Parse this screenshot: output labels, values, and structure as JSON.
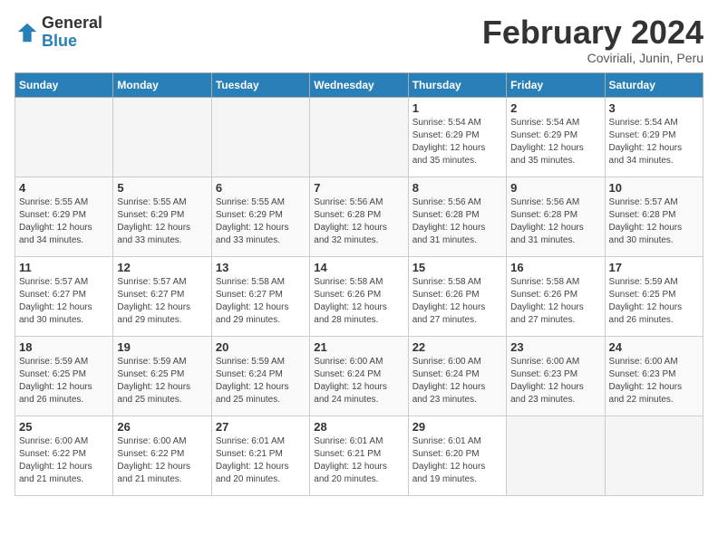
{
  "header": {
    "logo_general": "General",
    "logo_blue": "Blue",
    "month_title": "February 2024",
    "subtitle": "Coviriali, Junin, Peru"
  },
  "days_of_week": [
    "Sunday",
    "Monday",
    "Tuesday",
    "Wednesday",
    "Thursday",
    "Friday",
    "Saturday"
  ],
  "weeks": [
    [
      {
        "day": "",
        "info": ""
      },
      {
        "day": "",
        "info": ""
      },
      {
        "day": "",
        "info": ""
      },
      {
        "day": "",
        "info": ""
      },
      {
        "day": "1",
        "info": "Sunrise: 5:54 AM\nSunset: 6:29 PM\nDaylight: 12 hours\nand 35 minutes."
      },
      {
        "day": "2",
        "info": "Sunrise: 5:54 AM\nSunset: 6:29 PM\nDaylight: 12 hours\nand 35 minutes."
      },
      {
        "day": "3",
        "info": "Sunrise: 5:54 AM\nSunset: 6:29 PM\nDaylight: 12 hours\nand 34 minutes."
      }
    ],
    [
      {
        "day": "4",
        "info": "Sunrise: 5:55 AM\nSunset: 6:29 PM\nDaylight: 12 hours\nand 34 minutes."
      },
      {
        "day": "5",
        "info": "Sunrise: 5:55 AM\nSunset: 6:29 PM\nDaylight: 12 hours\nand 33 minutes."
      },
      {
        "day": "6",
        "info": "Sunrise: 5:55 AM\nSunset: 6:29 PM\nDaylight: 12 hours\nand 33 minutes."
      },
      {
        "day": "7",
        "info": "Sunrise: 5:56 AM\nSunset: 6:28 PM\nDaylight: 12 hours\nand 32 minutes."
      },
      {
        "day": "8",
        "info": "Sunrise: 5:56 AM\nSunset: 6:28 PM\nDaylight: 12 hours\nand 31 minutes."
      },
      {
        "day": "9",
        "info": "Sunrise: 5:56 AM\nSunset: 6:28 PM\nDaylight: 12 hours\nand 31 minutes."
      },
      {
        "day": "10",
        "info": "Sunrise: 5:57 AM\nSunset: 6:28 PM\nDaylight: 12 hours\nand 30 minutes."
      }
    ],
    [
      {
        "day": "11",
        "info": "Sunrise: 5:57 AM\nSunset: 6:27 PM\nDaylight: 12 hours\nand 30 minutes."
      },
      {
        "day": "12",
        "info": "Sunrise: 5:57 AM\nSunset: 6:27 PM\nDaylight: 12 hours\nand 29 minutes."
      },
      {
        "day": "13",
        "info": "Sunrise: 5:58 AM\nSunset: 6:27 PM\nDaylight: 12 hours\nand 29 minutes."
      },
      {
        "day": "14",
        "info": "Sunrise: 5:58 AM\nSunset: 6:26 PM\nDaylight: 12 hours\nand 28 minutes."
      },
      {
        "day": "15",
        "info": "Sunrise: 5:58 AM\nSunset: 6:26 PM\nDaylight: 12 hours\nand 27 minutes."
      },
      {
        "day": "16",
        "info": "Sunrise: 5:58 AM\nSunset: 6:26 PM\nDaylight: 12 hours\nand 27 minutes."
      },
      {
        "day": "17",
        "info": "Sunrise: 5:59 AM\nSunset: 6:25 PM\nDaylight: 12 hours\nand 26 minutes."
      }
    ],
    [
      {
        "day": "18",
        "info": "Sunrise: 5:59 AM\nSunset: 6:25 PM\nDaylight: 12 hours\nand 26 minutes."
      },
      {
        "day": "19",
        "info": "Sunrise: 5:59 AM\nSunset: 6:25 PM\nDaylight: 12 hours\nand 25 minutes."
      },
      {
        "day": "20",
        "info": "Sunrise: 5:59 AM\nSunset: 6:24 PM\nDaylight: 12 hours\nand 25 minutes."
      },
      {
        "day": "21",
        "info": "Sunrise: 6:00 AM\nSunset: 6:24 PM\nDaylight: 12 hours\nand 24 minutes."
      },
      {
        "day": "22",
        "info": "Sunrise: 6:00 AM\nSunset: 6:24 PM\nDaylight: 12 hours\nand 23 minutes."
      },
      {
        "day": "23",
        "info": "Sunrise: 6:00 AM\nSunset: 6:23 PM\nDaylight: 12 hours\nand 23 minutes."
      },
      {
        "day": "24",
        "info": "Sunrise: 6:00 AM\nSunset: 6:23 PM\nDaylight: 12 hours\nand 22 minutes."
      }
    ],
    [
      {
        "day": "25",
        "info": "Sunrise: 6:00 AM\nSunset: 6:22 PM\nDaylight: 12 hours\nand 21 minutes."
      },
      {
        "day": "26",
        "info": "Sunrise: 6:00 AM\nSunset: 6:22 PM\nDaylight: 12 hours\nand 21 minutes."
      },
      {
        "day": "27",
        "info": "Sunrise: 6:01 AM\nSunset: 6:21 PM\nDaylight: 12 hours\nand 20 minutes."
      },
      {
        "day": "28",
        "info": "Sunrise: 6:01 AM\nSunset: 6:21 PM\nDaylight: 12 hours\nand 20 minutes."
      },
      {
        "day": "29",
        "info": "Sunrise: 6:01 AM\nSunset: 6:20 PM\nDaylight: 12 hours\nand 19 minutes."
      },
      {
        "day": "",
        "info": ""
      },
      {
        "day": "",
        "info": ""
      }
    ]
  ]
}
